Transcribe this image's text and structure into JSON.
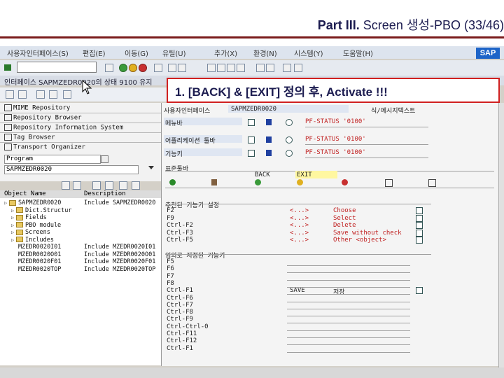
{
  "slide": {
    "title_prefix": "Part III.",
    "title_rest": "Screen 생성-PBO (33/46)"
  },
  "menu": {
    "items": [
      "사용자인터페이스(S)",
      "편집(E)",
      "이동(G)",
      "유틸(U)",
      "추가(X)",
      "환경(N)",
      "시스템(Y)",
      "도움말(H)"
    ]
  },
  "title_bar": {
    "text": "인터페이스 SAPMZEDR0020의 상태 9100 유지"
  },
  "callout": {
    "text": "1. [BACK] & [EXIT] 정의 후, Activate !!!"
  },
  "navigator": {
    "items": [
      "MIME Repository",
      "Repository Browser",
      "Repository Information System",
      "Tag Browser",
      "Transport Organizer"
    ],
    "object_type": "Program",
    "object_name": "SAPMZEDR0020",
    "columns": [
      "Object Name",
      "Description"
    ]
  },
  "tree": [
    {
      "name": "SAPMZEDR0020",
      "desc": "Include SAPMZEDR0020",
      "level": 0,
      "folder": true
    },
    {
      "name": "Dict.Structur",
      "desc": "",
      "level": 1,
      "folder": true
    },
    {
      "name": "Fields",
      "desc": "",
      "level": 1,
      "folder": true
    },
    {
      "name": "PBO module",
      "desc": "",
      "level": 1,
      "folder": true
    },
    {
      "name": "Screens",
      "desc": "",
      "level": 1,
      "folder": true
    },
    {
      "name": "Includes",
      "desc": "",
      "level": 1,
      "folder": true
    },
    {
      "name": "MZEDR0020I01",
      "desc": "Include MZEDR0020I01",
      "level": 2,
      "folder": false
    },
    {
      "name": "MZEDR0020O01",
      "desc": "Include MZEDR0020O01",
      "level": 2,
      "folder": false
    },
    {
      "name": "MZEDR0020F01",
      "desc": "Include MZEDR0020F01",
      "level": 2,
      "folder": false
    },
    {
      "name": "MZEDR0020TOP",
      "desc": "Include MZEDR0020TOP",
      "level": 2,
      "folder": false
    }
  ],
  "editor": {
    "ui_interface_label": "사용자인터페이스",
    "ui_interface_value": "SAPMZEDR0020",
    "activation_status": "식/메시지텍스트",
    "rows": [
      {
        "label": "메뉴바",
        "status": "PF-STATUS '0100'"
      },
      {
        "label": "어플리케이션 툴바",
        "status": "PF-STATUS '0100'"
      },
      {
        "label": "기능키",
        "status": "PF-STATUS '0100'"
      }
    ],
    "std_toolbar_label": "표준툴바",
    "std_values": {
      "back": "BACK",
      "exit": "EXIT"
    },
    "recommended_header": "추천된 기능키 설정",
    "recommended_keys": [
      "F2",
      "F9",
      "Ctrl-F2",
      "Ctrl-F3",
      "Ctrl-F5"
    ],
    "recommended_objects": [
      "<...>",
      "<...>",
      "<...>",
      "<...>",
      "<...>"
    ],
    "recommended_actions": [
      "Choose",
      "Select",
      "Delete",
      "Save without check",
      "Other <object>"
    ],
    "freely_header": "임의로 지정된 기능키",
    "free_keys": [
      "F5",
      "F6",
      "F7",
      "F8",
      "Ctrl-F1",
      "Ctrl-F6",
      "Ctrl-F7",
      "Ctrl-F8",
      "Ctrl-F9",
      "Ctrl-Ctrl-0",
      "Ctrl-F11",
      "Ctrl-F12",
      "Ctrl-F1"
    ],
    "save_code": "SAVE",
    "save_text": "저장"
  },
  "colors": {
    "accent_red": "#c02020",
    "title_blue": "#1c1c50",
    "sap_blue": "#1d64c8"
  }
}
